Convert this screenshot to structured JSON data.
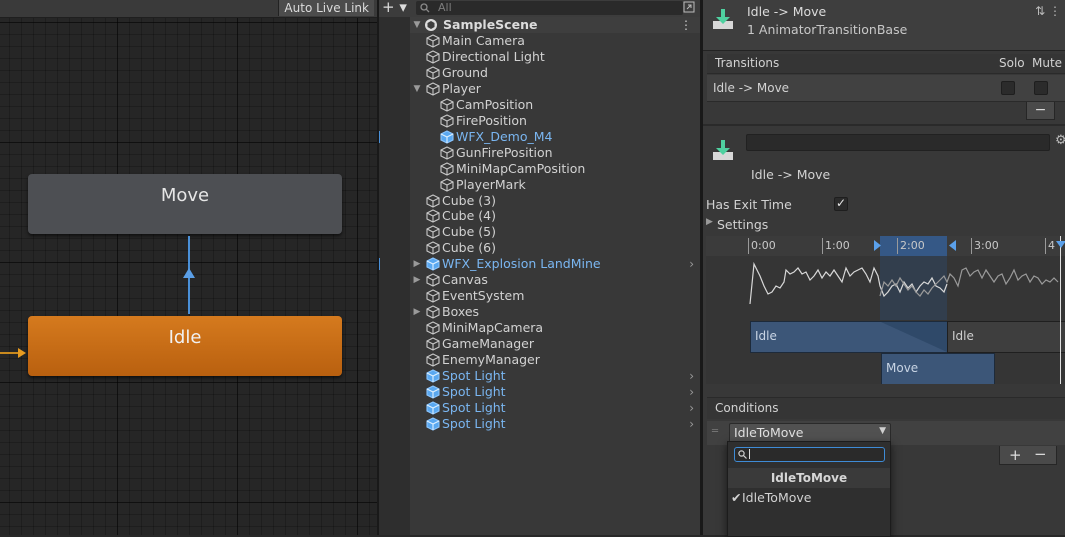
{
  "animator": {
    "auto_live_link": "Auto Live Link",
    "states": {
      "move": "Move",
      "idle": "Idle"
    }
  },
  "hierarchy": {
    "add_label": "+ ▾",
    "search_placeholder": "All",
    "scene": "SampleScene",
    "items": [
      {
        "label": "Main Camera"
      },
      {
        "label": "Directional Light"
      },
      {
        "label": "Ground"
      },
      {
        "label": "Player"
      },
      {
        "label": "CamPosition"
      },
      {
        "label": "FirePosition"
      },
      {
        "label": "WFX_Demo_M4"
      },
      {
        "label": "GunFirePosition"
      },
      {
        "label": "MiniMapCamPosition"
      },
      {
        "label": "PlayerMark"
      },
      {
        "label": "Cube (3)"
      },
      {
        "label": "Cube (4)"
      },
      {
        "label": "Cube (5)"
      },
      {
        "label": "Cube (6)"
      },
      {
        "label": "WFX_Explosion LandMine"
      },
      {
        "label": "Canvas"
      },
      {
        "label": "EventSystem"
      },
      {
        "label": "Boxes"
      },
      {
        "label": "MiniMapCamera"
      },
      {
        "label": "GameManager"
      },
      {
        "label": "EnemyManager"
      },
      {
        "label": "Spot Light"
      },
      {
        "label": "Spot Light"
      },
      {
        "label": "Spot Light"
      },
      {
        "label": "Spot Light"
      }
    ]
  },
  "inspector": {
    "title": "Idle -> Move",
    "subtitle": "1 AnimatorTransitionBase",
    "transitions": {
      "header": "Transitions",
      "solo": "Solo",
      "mute": "Mute",
      "row": "Idle -> Move",
      "minus": "−"
    },
    "transition_title": "Idle -> Move",
    "has_exit_time": "Has Exit Time",
    "has_exit_time_checked": "✓",
    "settings": "Settings",
    "timeline": {
      "ticks": [
        "0:00",
        "1:00",
        "2:00",
        "3:00",
        "4"
      ],
      "idle1": "Idle",
      "idle2": "Idle",
      "move": "Move"
    },
    "conditions": {
      "header": "Conditions",
      "selected": "IdleToMove",
      "plus": "+",
      "minus": "−"
    },
    "dropdown": {
      "header": "IdleToMove",
      "check": "✔",
      "item": "IdleToMove"
    }
  },
  "colors": {
    "state_move": "#4d4f53",
    "state_idle": "#c96d16",
    "transition": "#4a90d8",
    "prefab_text": "#7ab6f1"
  }
}
